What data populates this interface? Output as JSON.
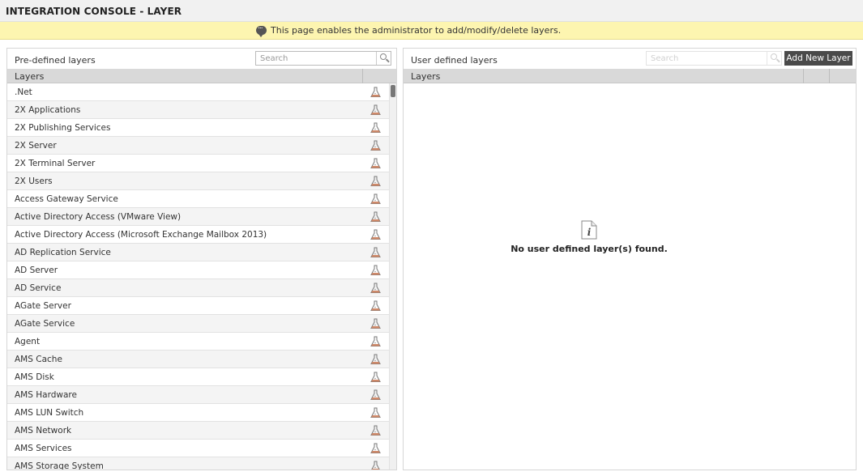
{
  "header": {
    "title": "INTEGRATION CONSOLE - LAYER"
  },
  "info": {
    "message": "This page enables the administrator to add/modify/delete layers.",
    "icon": "speech-bubble-icon"
  },
  "left_panel": {
    "title": "Pre-defined layers",
    "search_placeholder": "Search",
    "column_header": "Layers",
    "row_icon": "flask-icon",
    "rows": [
      ".Net",
      "2X Applications",
      "2X Publishing Services",
      "2X Server",
      "2X Terminal Server",
      "2X Users",
      "Access Gateway Service",
      "Active Directory Access (VMware View)",
      "Active Directory Access (Microsoft Exchange Mailbox 2013)",
      "AD Replication Service",
      "AD Server",
      "AD Service",
      "AGate Server",
      "AGate Service",
      "Agent",
      "AMS Cache",
      "AMS Disk",
      "AMS Hardware",
      "AMS LUN Switch",
      "AMS Network",
      "AMS Services",
      "AMS Storage System"
    ]
  },
  "right_panel": {
    "title": "User defined layers",
    "search_placeholder": "Search",
    "add_button_label": "Add New Layer",
    "column_header": "Layers",
    "empty_message": "No user defined layer(s) found.",
    "empty_icon": "info-document-icon"
  },
  "colors": {
    "info_bar": "#fdf5b0",
    "header_bg": "#d9d9d9",
    "button_bg": "#4a4a4a"
  }
}
